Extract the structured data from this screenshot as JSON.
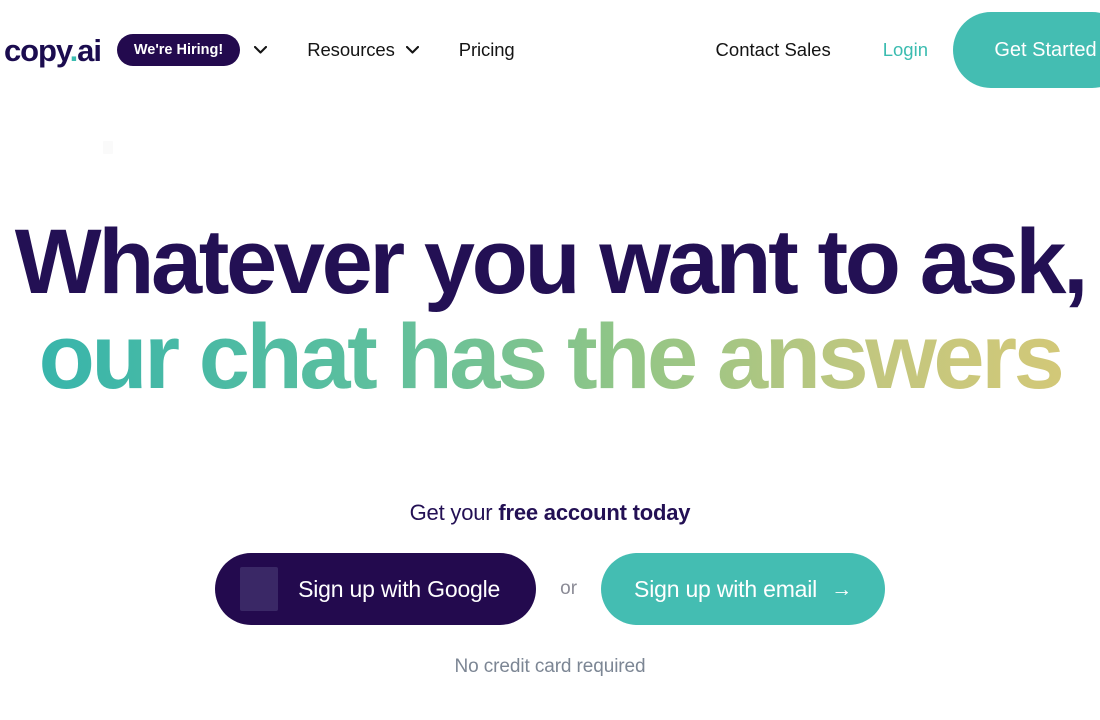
{
  "brand": {
    "logo_main": "copy",
    "logo_dot": ".",
    "logo_suffix": "ai",
    "navy": "#231054",
    "teal": "#44bdb2",
    "deep_purple": "#230a4e"
  },
  "navbar": {
    "hiring_badge": "We're Hiring!",
    "links": [
      {
        "label": "Resources",
        "has_chevron": true
      },
      {
        "label": "Pricing",
        "has_chevron": false
      }
    ],
    "contact_sales": "Contact Sales",
    "login": "Login",
    "get_started": "Get Started"
  },
  "hero": {
    "headline_line1": "Whatever you want to ask,",
    "headline_line2": "our chat has the answers",
    "gradient_start": "#38b5ab",
    "gradient_end": "#d2c878"
  },
  "signup": {
    "subhead_lead": "Get your ",
    "subhead_bold": "free account today",
    "google_button": "Sign up with Google",
    "or": "or",
    "email_button": "Sign up with email",
    "email_button_arrow": "→",
    "no_credit_card": "No credit card required"
  }
}
